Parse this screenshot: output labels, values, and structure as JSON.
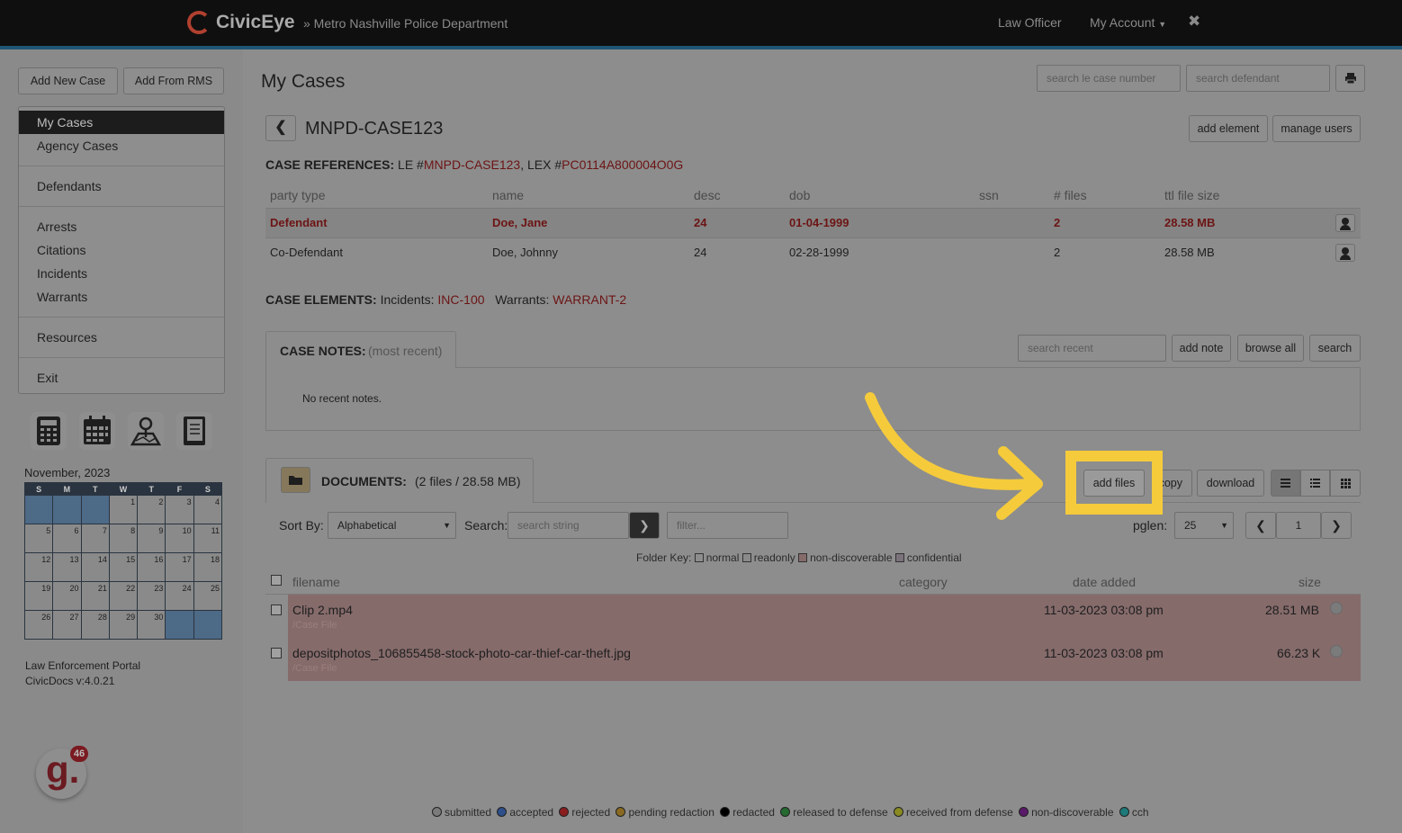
{
  "header": {
    "brand": "CivicEye",
    "department": "» Metro Nashville Police Department",
    "role": "Law Officer",
    "account": "My Account",
    "close": "✖"
  },
  "sidebar": {
    "add_new_case": "Add New Case",
    "add_from_rms": "Add From RMS",
    "menu": [
      "My Cases",
      "Agency Cases",
      "Defendants",
      "Arrests",
      "Citations",
      "Incidents",
      "Warrants",
      "Resources",
      "Exit"
    ],
    "tools": [
      "calculator-icon",
      "calendar-icon",
      "map-icon",
      "notebook-icon"
    ],
    "calendar": {
      "title": "November, 2023",
      "days": [
        "S",
        "M",
        "T",
        "W",
        "T",
        "F",
        "S"
      ],
      "weeks": [
        [
          "",
          "",
          "",
          "1",
          "2",
          "3",
          "4"
        ],
        [
          "5",
          "6",
          "7",
          "8",
          "9",
          "10",
          "11"
        ],
        [
          "12",
          "13",
          "14",
          "15",
          "16",
          "17",
          "18"
        ],
        [
          "19",
          "20",
          "21",
          "22",
          "23",
          "24",
          "25"
        ],
        [
          "26",
          "27",
          "28",
          "29",
          "30",
          "",
          ""
        ]
      ]
    },
    "footer_line1": "Law Enforcement Portal",
    "footer_line2": "CivicDocs v:4.0.21",
    "badge_count": "46"
  },
  "main": {
    "title": "My Cases",
    "search_case_placeholder": "search le case number",
    "search_defendant_placeholder": "search defendant",
    "case_id": "MNPD-CASE123",
    "add_element": "add element",
    "manage_users": "manage users",
    "case_refs_label": "CASE REFERENCES:",
    "case_refs_le": "LE #",
    "case_refs_le_val": "MNPD-CASE123",
    "case_refs_lex": ", LEX #",
    "case_refs_lex_val": "PC0114A800004O0G",
    "parties": {
      "headers": [
        "party type",
        "name",
        "desc",
        "dob",
        "ssn",
        "# files",
        "ttl file size"
      ],
      "rows": [
        [
          "Defendant",
          "Doe, Jane",
          "24",
          "01-04-1999",
          "",
          "2",
          "28.58 MB"
        ],
        [
          "Co-Defendant",
          "Doe, Johnny",
          "24",
          "02-28-1999",
          "",
          "2",
          "28.58 MB"
        ]
      ]
    },
    "case_elements_label": "CASE ELEMENTS:",
    "incidents_label": "Incidents:",
    "incidents_val": "INC-100",
    "warrants_label": "Warrants:",
    "warrants_val": "WARRANT-2",
    "notes": {
      "label": "CASE NOTES:",
      "sub": "(most recent)",
      "search_placeholder": "search recent",
      "add_note": "add note",
      "browse_all": "browse all",
      "search": "search",
      "empty": "No recent notes."
    },
    "documents": {
      "label": "DOCUMENTS:",
      "summary": "(2 files / 28.58 MB)",
      "add_files": "add files",
      "copy": "copy",
      "download": "download",
      "sort_label": "Sort By:",
      "sort_value": "Alphabetical",
      "search_label": "Search:",
      "search_placeholder": "search string",
      "filter_placeholder": "filter...",
      "pglen_label": "pglen:",
      "pglen_value": "25",
      "page": "1",
      "folder_key_label": "Folder Key:",
      "folder_keys": [
        "normal",
        "readonly",
        "non-discoverable",
        "confidential"
      ],
      "headers": {
        "filename": "filename",
        "category": "category",
        "date": "date added",
        "size": "size"
      },
      "files": [
        {
          "name": "Clip 2.mp4",
          "folder": "/Case File",
          "date": "11-03-2023 03:08 pm",
          "size": "28.51 MB"
        },
        {
          "name": "depositphotos_106855458-stock-photo-car-thief-car-theft.jpg",
          "folder": "/Case File",
          "date": "11-03-2023 03:08 pm",
          "size": "66.23 K"
        }
      ]
    },
    "legend": [
      {
        "label": "submitted",
        "color": "#7b7b7b"
      },
      {
        "label": "accepted",
        "color": "#2e4f8a"
      },
      {
        "label": "rejected",
        "color": "#8a1e1e"
      },
      {
        "label": "pending redaction",
        "color": "#8a6a22"
      },
      {
        "label": "redacted",
        "color": "#000000"
      },
      {
        "label": "released to defense",
        "color": "#256a31"
      },
      {
        "label": "received from defense",
        "color": "#8a8a22"
      },
      {
        "label": "non-discoverable",
        "color": "#5a1a6a"
      },
      {
        "label": "cch",
        "color": "#1e7a7a"
      }
    ]
  },
  "colors": {
    "accent": "#f5cb3c",
    "link_red": "#6d1414",
    "file_row": "#866b6b"
  }
}
